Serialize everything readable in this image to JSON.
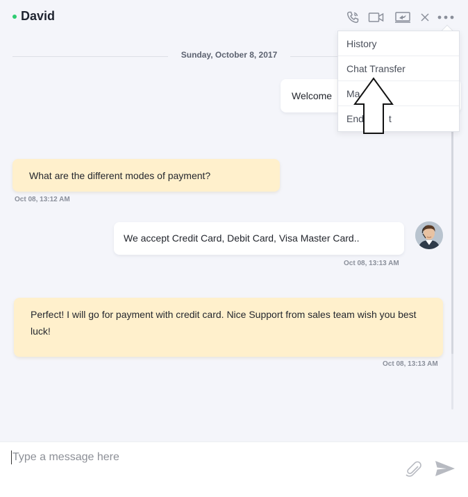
{
  "header": {
    "contact_name": "David",
    "status_color": "#2ecc71",
    "icons": [
      "phone-icon",
      "video-icon",
      "screen-share-icon",
      "close-icon",
      "more-icon"
    ]
  },
  "dropdown": {
    "items": [
      {
        "label": "History"
      },
      {
        "label": "Chat Transfer"
      },
      {
        "label": "Ma"
      },
      {
        "label": "End"
      },
      {
        "label": "t"
      }
    ]
  },
  "date_divider": "Sunday, October 8, 2017",
  "messages": [
    {
      "from": "agent",
      "text": "Welcome",
      "time": ""
    },
    {
      "from": "customer",
      "text": "What are the different modes of payment?",
      "time": "Oct 08, 13:12 AM"
    },
    {
      "from": "agent",
      "text": "We accept Credit Card, Debit Card, Visa Master Card..",
      "time": "Oct 08, 13:13 AM"
    },
    {
      "from": "customer",
      "text": "Perfect! I will go for payment with credit card. Nice Support from sales team wish you best luck!",
      "time": "Oct 08, 13:13 AM"
    }
  ],
  "composer": {
    "placeholder": "Type a message here",
    "value": ""
  },
  "colors": {
    "customer_bubble": "#fff0cc",
    "agent_bubble": "#ffffff",
    "background": "#f4f5fa"
  }
}
